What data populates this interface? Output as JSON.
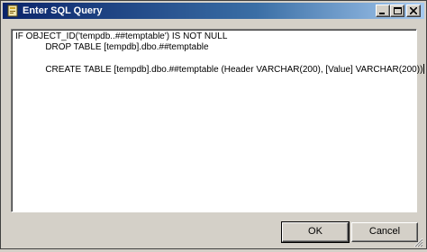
{
  "window": {
    "title": "Enter SQL Query",
    "controls": {
      "minimize_icon": "minimize-icon",
      "maximize_icon": "maximize-icon",
      "close_icon": "close-icon"
    }
  },
  "editor": {
    "lines": [
      "IF OBJECT_ID('tempdb..##temptable') IS NOT NULL",
      "            DROP TABLE [tempdb].dbo.##temptable",
      "",
      "            CREATE TABLE [tempdb].dbo.##temptable (Header VARCHAR(200), [Value] VARCHAR(200))"
    ]
  },
  "buttons": {
    "ok_label": "OK",
    "cancel_label": "Cancel"
  },
  "colors": {
    "titlebar_start": "#0a246a",
    "titlebar_end": "#a6caf0",
    "face": "#d4d0c8"
  }
}
